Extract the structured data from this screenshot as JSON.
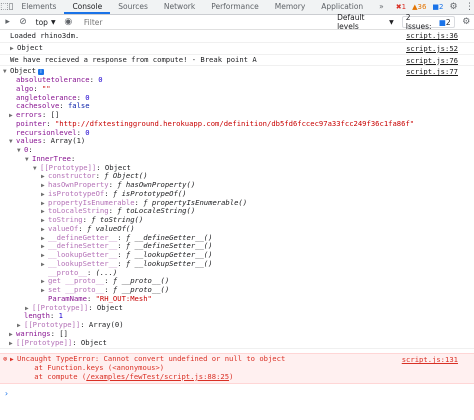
{
  "tabbar": {
    "tabs": [
      "Elements",
      "Console",
      "Sources",
      "Network",
      "Performance",
      "Memory",
      "Application"
    ],
    "active_tab": "Console",
    "more": "»",
    "errors_count": "1",
    "warnings_count": "36",
    "info_count": "2"
  },
  "toolbar": {
    "context": "top",
    "filter_placeholder": "Filter",
    "levels": "Default levels",
    "issues": "2 Issues:",
    "issues_count": "2"
  },
  "console": {
    "msg1": {
      "text": "Loaded rhino3dm.",
      "src": "script.js:36"
    },
    "msg2": {
      "text": "Object",
      "src": "script.js:52"
    },
    "msg3": {
      "text": "We have recieved a response from compute! - Break point A",
      "src": "script.js:76"
    },
    "obj": {
      "label": "Object",
      "src": "script.js:77",
      "info": "i",
      "props": [
        {
          "k": "absolutetolerance",
          "v": "0",
          "t": "num"
        },
        {
          "k": "algo",
          "v": "\"\"",
          "t": "str"
        },
        {
          "k": "angletolerance",
          "v": "0",
          "t": "num"
        },
        {
          "k": "cachesolve",
          "v": "false",
          "t": "kw"
        },
        {
          "k": "errors",
          "v": "[]",
          "t": "plain"
        },
        {
          "k": "pointer",
          "v": "\"http://dfxtestingground.herokuapp.com/definition/db5fd6fccec97a33fcc249f36c1fa86f\"",
          "t": "str"
        },
        {
          "k": "recursionlevel",
          "v": "0",
          "t": "num"
        }
      ],
      "values_k": "values",
      "values_v": "Array(1)",
      "zero_k": "0",
      "innertree_k": "InnerTree",
      "innertree_v": "Object",
      "prototype_k": "[[Prototype]]",
      "prototype_v": "Object",
      "proto_items": [
        {
          "k": "constructor",
          "v": "ƒ Object()"
        },
        {
          "k": "hasOwnProperty",
          "v": "ƒ hasOwnProperty()"
        },
        {
          "k": "isPrototypeOf",
          "v": "ƒ isPrototypeOf()"
        },
        {
          "k": "propertyIsEnumerable",
          "v": "ƒ propertyIsEnumerable()"
        },
        {
          "k": "toLocaleString",
          "v": "ƒ toLocaleString()"
        },
        {
          "k": "toString",
          "v": "ƒ toString()"
        },
        {
          "k": "valueOf",
          "v": "ƒ valueOf()"
        },
        {
          "k": "__defineGetter__",
          "v": "ƒ __defineGetter__()"
        },
        {
          "k": "__defineSetter__",
          "v": "ƒ __defineSetter__()"
        },
        {
          "k": "__lookupGetter__",
          "v": "ƒ __lookupGetter__()"
        },
        {
          "k": "__lookupSetter__",
          "v": "ƒ __lookupSetter__()"
        },
        {
          "k": "__proto__",
          "v": "(...)"
        },
        {
          "k": "get __proto__",
          "v": "ƒ __proto__()"
        },
        {
          "k": "set __proto__",
          "v": "ƒ __proto__()"
        }
      ],
      "paramname_k": "ParamName",
      "paramname_v": "\"RH_OUT:Mesh\"",
      "proto2_k": "[[Prototype]]",
      "proto2_v": "Object",
      "length_k": "length",
      "length_v": "1",
      "proto3_k": "[[Prototype]]",
      "proto3_v": "Array(0)",
      "warnings_k": "warnings",
      "warnings_v": "[]",
      "proto4_k": "[[Prototype]]",
      "proto4_v": "Object"
    },
    "error": {
      "line1": "Uncaught TypeError: Cannot convert undefined or null to object",
      "line2": "    at Function.keys (<anonymous>)",
      "line3_prefix": "    at compute (",
      "line3_link": "/examples/fewTest/script.js:88:25",
      "line3_suffix": ")",
      "src": "script.js:131"
    },
    "prompt": "›"
  }
}
